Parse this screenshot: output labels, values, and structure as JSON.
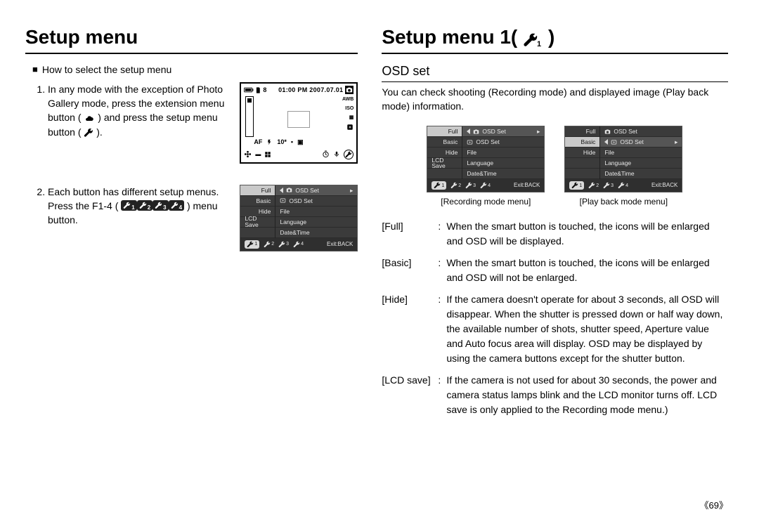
{
  "left": {
    "title": "Setup menu",
    "how_to": "How to select the setup menu",
    "step1_a": "In any mode with the exception of Photo Gallery mode, press the extension menu button (",
    "step1_b": ") and press the setup menu button (",
    "step1_c": ").",
    "step2_a": "Each button has different setup menus. Press the F1-4 (",
    "step2_b": ") menu button."
  },
  "right": {
    "title": "Setup menu 1(",
    "title_close": ")",
    "subtitle": "OSD set",
    "intro": "You can check shooting (Recording mode) and displayed image (Play back mode) information.",
    "caption_rec": "[Recording mode menu]",
    "caption_play": "[Play back mode menu]",
    "defs": [
      {
        "label": "[Full]",
        "text": "When the smart button is touched, the icons will be enlarged and OSD will be displayed."
      },
      {
        "label": "[Basic]",
        "text": "When the smart button is touched, the icons will be enlarged and OSD will not be enlarged."
      },
      {
        "label": "[Hide]",
        "text": "If the camera doesn't operate for about 3 seconds, all OSD will disappear. When the shutter is pressed down or half way down, the available number of shots, shutter speed, Aperture value and Auto focus area will display. OSD may be displayed by using the camera buttons except for the shutter button."
      },
      {
        "label": "[LCD save]",
        "text": "If the camera is not used for about 30 seconds, the power and camera status lamps blink and the LCD monitor turns off. LCD save is only applied to the Recording mode menu.)"
      }
    ]
  },
  "lcd": {
    "count": "8",
    "datetime": "01:00 PM 2007.07.01",
    "awb": "AWB",
    "iso": "ISO",
    "af": "AF",
    "ten": "10*"
  },
  "menu_full": {
    "left_items": [
      "Full",
      "Basic",
      "Hide",
      "LCD Save",
      ""
    ],
    "right_items": [
      "OSD Set",
      "OSD Set",
      "File",
      "Language",
      "Date&Time"
    ],
    "exit": "Exit:BACK"
  },
  "menu_play": {
    "left_items": [
      "Full",
      "Basic",
      "Hide",
      "",
      ""
    ],
    "right_items": [
      "OSD Set",
      "OSD Set",
      "File",
      "Language",
      "Date&Time"
    ],
    "exit": "Exit:BACK"
  },
  "pagenum": "69",
  "pagenum_l": "《",
  "pagenum_r": "》"
}
